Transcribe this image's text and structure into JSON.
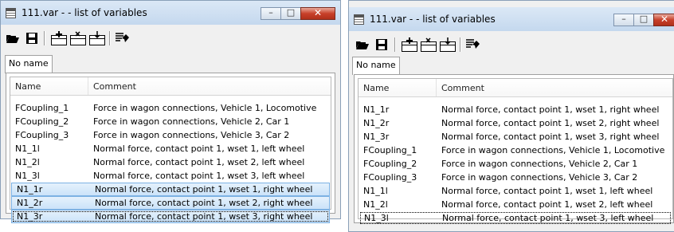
{
  "left_window": {
    "title": "111.var -  - list of variables",
    "tab_label": "No name",
    "columns": {
      "name": "Name",
      "comment": "Comment"
    },
    "rows": [
      {
        "name": "FCoupling_1",
        "comment": "Force in wagon connections, Vehicle 1, Locomotive"
      },
      {
        "name": "FCoupling_2",
        "comment": "Force in wagon connections, Vehicle 2, Car 1"
      },
      {
        "name": "FCoupling_3",
        "comment": "Force in wagon connections, Vehicle 3, Car 2"
      },
      {
        "name": "N1_1l",
        "comment": "Normal force, contact point 1, wset 1, left wheel"
      },
      {
        "name": "N1_2l",
        "comment": "Normal force, contact point 1, wset 2, left wheel"
      },
      {
        "name": "N1_3l",
        "comment": "Normal force, contact point 1, wset 3, left wheel"
      },
      {
        "name": "N1_1r",
        "comment": "Normal force, contact point 1, wset 1, right wheel"
      },
      {
        "name": "N1_2r",
        "comment": "Normal force, contact point 1, wset 2, right wheel"
      },
      {
        "name": "N1_3r",
        "comment": "Normal force, contact point 1, wset 3, right wheel"
      }
    ]
  },
  "right_window": {
    "title": "111.var -  - list of variables",
    "tab_label": "No name",
    "columns": {
      "name": "Name",
      "comment": "Comment"
    },
    "rows": [
      {
        "name": "N1_1r",
        "comment": "Normal force, contact point 1, wset 1, right wheel"
      },
      {
        "name": "N1_2r",
        "comment": "Normal force, contact point 1, wset 2, right wheel"
      },
      {
        "name": "N1_3r",
        "comment": "Normal force, contact point 1, wset 3, right wheel"
      },
      {
        "name": "FCoupling_1",
        "comment": "Force in wagon connections, Vehicle 1, Locomotive"
      },
      {
        "name": "FCoupling_2",
        "comment": "Force in wagon connections, Vehicle 2, Car 1"
      },
      {
        "name": "FCoupling_3",
        "comment": "Force in wagon connections, Vehicle 3, Car 2"
      },
      {
        "name": "N1_1l",
        "comment": "Normal force, contact point 1, wset 1, left wheel"
      },
      {
        "name": "N1_2l",
        "comment": "Normal force, contact point 1, wset 2, left wheel"
      },
      {
        "name": "N1_3l",
        "comment": "Normal force, contact point 1, wset 3, left wheel"
      }
    ]
  },
  "toolbar_icons": [
    "open-folder-icon",
    "save-icon",
    "add-variable-icon",
    "remove-variable-icon",
    "edit-variable-icon",
    "sort-icon"
  ],
  "colors": {
    "selection_fill": "#cbe3f9",
    "selection_border": "#7db2e3",
    "close_button": "#c8402a",
    "title_gradient": "#c4d8ee"
  }
}
